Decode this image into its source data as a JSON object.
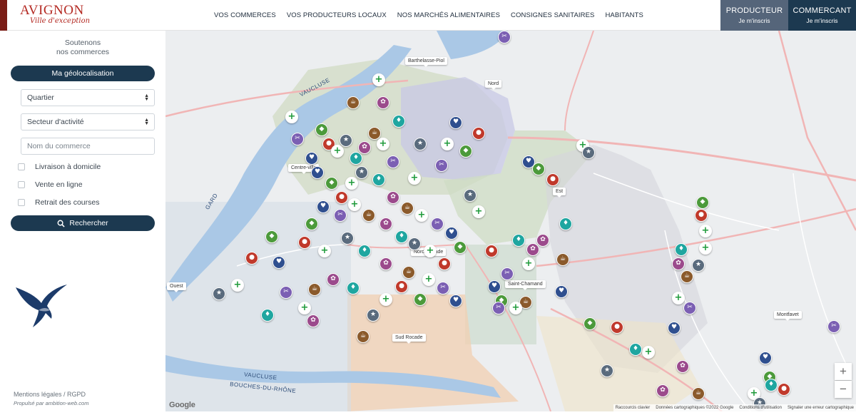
{
  "header": {
    "logo_title": "AVIGNON",
    "logo_subtitle": "Ville d'exception",
    "nav": [
      "VOS COMMERCES",
      "VOS PRODUCTEURS LOCAUX",
      "NOS MARCHÉS ALIMENTAIRES",
      "CONSIGNES SANITAIRES",
      "HABITANTS"
    ],
    "producer": {
      "title": "PRODUCTEUR",
      "sub": "Je m'inscris"
    },
    "merchant": {
      "title": "COMMERCANT",
      "sub": "Je m'inscris"
    }
  },
  "sidebar": {
    "tagline_1": "Soutenons",
    "tagline_2": "nos commerces",
    "geo_button": "Ma géolocalisation",
    "select_quartier": "Quartier",
    "select_secteur": "Secteur d'activité",
    "input_placeholder": "Nom du commerce",
    "checkbox_1": "Livraison à domicile",
    "checkbox_2": "Vente en ligne",
    "checkbox_3": "Retrait des courses",
    "search_button": "Rechercher",
    "legal": "Mentions légales / RGPD",
    "powered": "Propulsé par ambition-web.com"
  },
  "map": {
    "district_labels": [
      "Barthelasse-Piol",
      "Nord",
      "Centre-ville",
      "Est",
      "Nord Rocade",
      "Saint-Chamand",
      "Ouest",
      "Sud Rocade",
      "Montfavet"
    ],
    "water_labels": [
      "VAUCLUSE",
      "GARD",
      "VAUCLUSE",
      "BOUCHES-DU-RHÔNE"
    ],
    "zoom_in": "+",
    "zoom_out": "−",
    "google": "Google",
    "attribution": [
      "Raccourcis clavier",
      "Données cartographiques ©2022 Google",
      "Conditions d'utilisation",
      "Signaler une erreur cartographique"
    ]
  },
  "colors": {
    "navy": "#1c3950",
    "slate": "#55657a",
    "brand_red": "#b42a23",
    "pin_green": "#1e9a3a"
  }
}
